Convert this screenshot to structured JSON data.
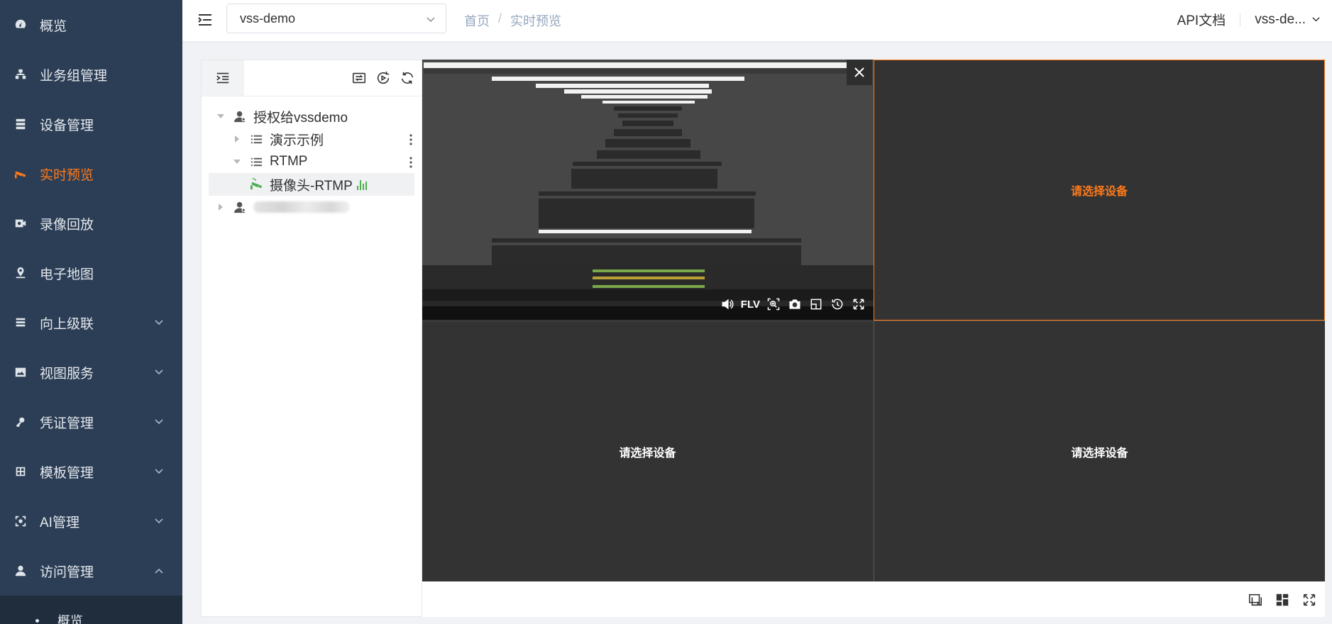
{
  "sidebar": {
    "items": [
      {
        "label": "概览",
        "icon": "dashboard-icon"
      },
      {
        "label": "业务组管理",
        "icon": "org-icon"
      },
      {
        "label": "设备管理",
        "icon": "server-icon"
      },
      {
        "label": "实时预览",
        "icon": "camera-icon",
        "active": true
      },
      {
        "label": "录像回放",
        "icon": "playback-icon"
      },
      {
        "label": "电子地图",
        "icon": "map-pin-icon"
      },
      {
        "label": "向上级联",
        "icon": "cascade-icon",
        "expandable": true
      },
      {
        "label": "视图服务",
        "icon": "image-icon",
        "expandable": true
      },
      {
        "label": "凭证管理",
        "icon": "key-icon",
        "expandable": true
      },
      {
        "label": "模板管理",
        "icon": "grid-icon",
        "expandable": true
      },
      {
        "label": "AI管理",
        "icon": "ai-icon",
        "expandable": true
      },
      {
        "label": "访问管理",
        "icon": "user-icon",
        "expanded": true
      }
    ],
    "submenu": [
      {
        "label": "概览"
      }
    ],
    "active_color": "#ff7a1a",
    "bg_color": "#2c3e55"
  },
  "header": {
    "org_select": {
      "value": "vss-demo"
    },
    "breadcrumb": [
      "首页",
      "实时预览"
    ],
    "api_docs": "API文档",
    "user": "vss-de..."
  },
  "tree": {
    "nodes": [
      {
        "label": "授权给vssdemo",
        "level": 0,
        "expanded": true,
        "icon": "user-group-icon"
      },
      {
        "label": "演示示例",
        "level": 1,
        "expanded": false,
        "icon": "list-icon"
      },
      {
        "label": "RTMP",
        "level": 1,
        "expanded": true,
        "icon": "list-icon"
      },
      {
        "label": "摄像头-RTMP",
        "level": 2,
        "icon": "camera-online-icon",
        "selected": true
      },
      {
        "label": "",
        "level": 0,
        "expanded": false,
        "icon": "user-group-icon",
        "blurred": true
      }
    ]
  },
  "player": {
    "format": "FLV",
    "placeholder": "请选择设备",
    "cells": [
      {
        "state": "playing"
      },
      {
        "state": "empty",
        "selected": true,
        "text": "请选择设备"
      },
      {
        "state": "empty",
        "text": "请选择设备"
      },
      {
        "state": "empty",
        "text": "请选择设备"
      }
    ],
    "highlight_color": "#ff7a1a"
  }
}
